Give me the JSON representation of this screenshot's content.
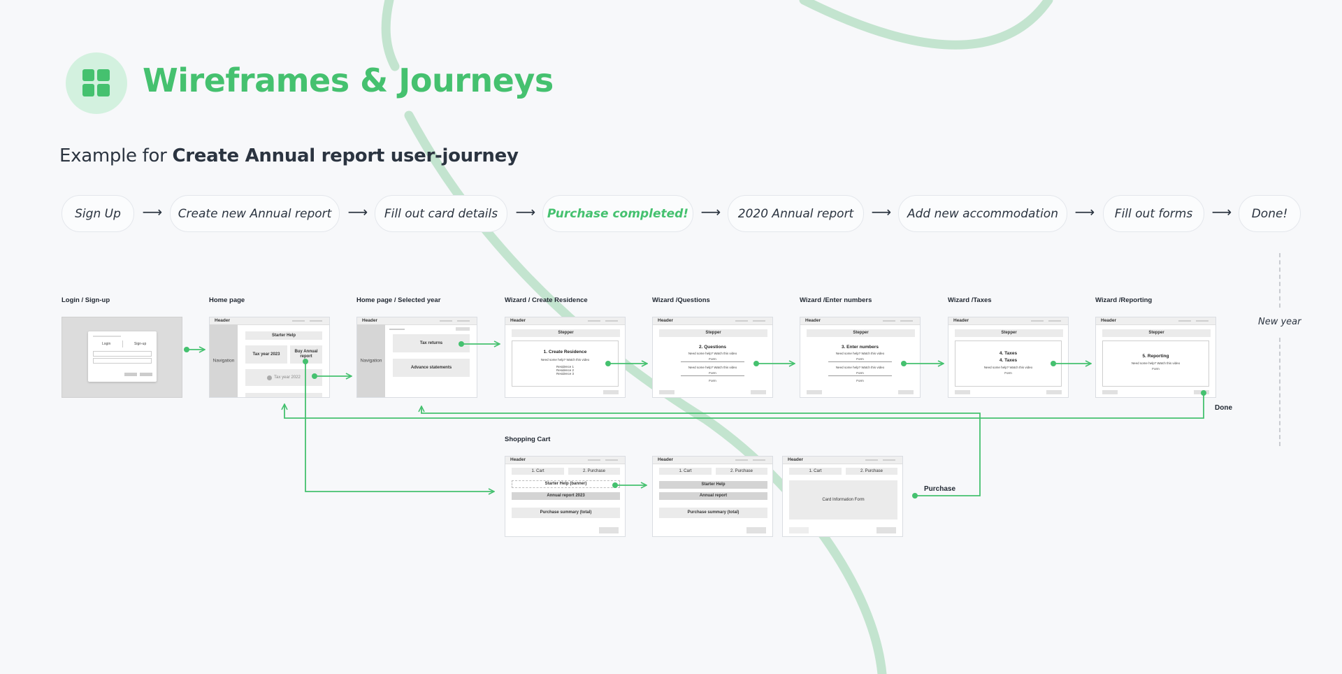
{
  "header": {
    "title": "Wireframes & Journeys",
    "logo_icon": "dashboard-grid-icon",
    "subtitle_prefix": "Example for ",
    "subtitle_bold": "Create Annual report user-journey"
  },
  "journey_steps": [
    {
      "label": "Sign Up"
    },
    {
      "label": "Create new Annual report"
    },
    {
      "label": "Fill out card details"
    },
    {
      "label": "Purchase completed!",
      "highlight": true
    },
    {
      "label": "2020 Annual report"
    },
    {
      "label": "Add new accommodation"
    },
    {
      "label": "Fill out forms"
    },
    {
      "label": "Done!"
    }
  ],
  "step_arrow": "⟶",
  "screens": {
    "login": {
      "label": "Login / Sign-up",
      "tab_login": "Login",
      "tab_signup": "Sign-up"
    },
    "home": {
      "label": "Home page",
      "header": "Header",
      "nav": "Navigation",
      "starter_help": "Starter Help",
      "tax_2023": "Tax year 2023",
      "buy_report": "Buy Annual report",
      "tax_2022": "Tax year 2022"
    },
    "home_selected": {
      "label": "Home page / Selected year",
      "header": "Header",
      "nav": "Navigation",
      "tax_returns": "Tax returns",
      "advance_statements": "Advance statements"
    },
    "wiz_residence": {
      "label": "Wizard / Create Residence",
      "header": "Header",
      "stepper": "Stepper",
      "title": "1. Create Residence",
      "question": "Need some help? Watch this video",
      "items": [
        "Residence 1",
        "Residence 2",
        "Residence 3"
      ]
    },
    "wiz_questions": {
      "label": "Wizard /Questions",
      "header": "Header",
      "stepper": "Stepper",
      "title": "2. Questions",
      "question": "Need some help? Watch this video",
      "form": "Form"
    },
    "wiz_numbers": {
      "label": "Wizard /Enter numbers",
      "header": "Header",
      "stepper": "Stepper",
      "title": "3. Enter numbers",
      "question": "Need some help? Watch this video",
      "form": "Form"
    },
    "wiz_taxes": {
      "label": "Wizard /Taxes",
      "header": "Header",
      "stepper": "Stepper",
      "title": "4. Taxes",
      "title2": "4. Taxes",
      "question": "Need some help? Watch this video",
      "form": "Form"
    },
    "wiz_reporting": {
      "label": "Wizard /Reporting",
      "header": "Header",
      "stepper": "Stepper",
      "title": "5. Reporting",
      "question": "Need some help? Watch this video",
      "form": "Form"
    },
    "cart1": {
      "label": "Shopping Cart",
      "header": "Header",
      "tab_cart": "1. Cart",
      "tab_purchase": "2. Purchase",
      "banner": "Starter Help (banner)",
      "report": "Annual report 2023",
      "summary": "Purchase summary (total)"
    },
    "cart2": {
      "header": "Header",
      "tab_cart": "1. Cart",
      "tab_purchase": "2. Purchase",
      "starter_help": "Starter Help",
      "report": "Annual report",
      "summary": "Purchase summary (total)"
    },
    "cart3": {
      "header": "Header",
      "tab_cart": "1. Cart",
      "tab_purchase": "2. Purchase",
      "card_form": "Card Information Form"
    }
  },
  "flow_labels": {
    "done": "Done",
    "purchase": "Purchase",
    "new_year": "New year"
  },
  "colors": {
    "accent": "#45c16f",
    "accent_light": "#d3f1df",
    "swirl": "#c3e4cf",
    "text": "#2b3440"
  }
}
